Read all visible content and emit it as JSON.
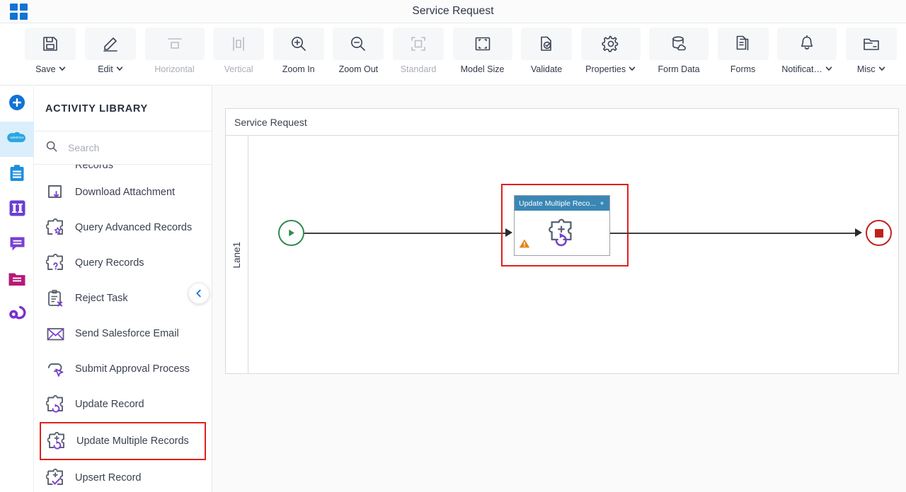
{
  "titlebar": {
    "title": "Service Request",
    "app_grid_icon": "apps-grid-icon"
  },
  "toolbar": {
    "buttons": [
      {
        "label": "Save",
        "icon": "save-disk-icon",
        "caret": true,
        "disabled": false
      },
      {
        "label": "Edit",
        "icon": "pencil-edit-icon",
        "caret": true,
        "disabled": false
      },
      {
        "label": "Horizontal",
        "icon": "horizontal-align-icon",
        "caret": false,
        "disabled": true
      },
      {
        "label": "Vertical",
        "icon": "vertical-align-icon",
        "caret": false,
        "disabled": true
      },
      {
        "label": "Zoom In",
        "icon": "zoom-in-icon",
        "caret": false,
        "disabled": false
      },
      {
        "label": "Zoom Out",
        "icon": "zoom-out-icon",
        "caret": false,
        "disabled": false
      },
      {
        "label": "Standard",
        "icon": "standard-frame-icon",
        "caret": false,
        "disabled": true
      },
      {
        "label": "Model Size",
        "icon": "model-size-icon",
        "caret": false,
        "disabled": false
      },
      {
        "label": "Validate",
        "icon": "validate-doc-icon",
        "caret": false,
        "disabled": false
      },
      {
        "label": "Properties",
        "icon": "gear-icon",
        "caret": true,
        "disabled": false
      },
      {
        "label": "Form Data",
        "icon": "database-cloud-icon",
        "caret": false,
        "disabled": false
      },
      {
        "label": "Forms",
        "icon": "documents-icon",
        "caret": false,
        "disabled": false
      },
      {
        "label": "Notificat…",
        "icon": "bell-icon",
        "caret": true,
        "disabled": false
      },
      {
        "label": "Misc",
        "icon": "folder-icon",
        "caret": true,
        "disabled": false
      }
    ]
  },
  "rail": {
    "items": [
      {
        "name": "add-new",
        "icon": "plus-circle-icon",
        "color": "#1273d4",
        "active": false
      },
      {
        "name": "salesforce",
        "icon": "salesforce-cloud-icon",
        "color": "#29a8e0",
        "active": true
      },
      {
        "name": "tasks",
        "icon": "clipboard-icon",
        "color": "#1d8fe0",
        "active": false
      },
      {
        "name": "swimlanes",
        "icon": "swimlane-icon",
        "color": "#6b3fd4",
        "active": false
      },
      {
        "name": "annotations",
        "icon": "comment-icon",
        "color": "#7a3fd4",
        "active": false
      },
      {
        "name": "folders",
        "icon": "folder-filled-icon",
        "color": "#b51a77",
        "active": false
      },
      {
        "name": "integrations",
        "icon": "spiral-icon",
        "color": "#7a30cf",
        "active": false
      }
    ]
  },
  "panel": {
    "title": "ACTIVITY LIBRARY",
    "search": {
      "value": "",
      "placeholder": "Search",
      "icon": "search-icon"
    },
    "collapse_icon": "chevron-left-icon",
    "clipped_top_item": "Records",
    "items": [
      {
        "label": "Download Attachment",
        "icon": "download-attachment-icon",
        "highlight": false
      },
      {
        "label": "Query Advanced Records",
        "icon": "puzzle-star-icon",
        "highlight": false
      },
      {
        "label": "Query Records",
        "icon": "puzzle-question-icon",
        "highlight": false
      },
      {
        "label": "Reject Task",
        "icon": "reject-task-icon",
        "highlight": false
      },
      {
        "label": "Send Salesforce Email",
        "icon": "envelope-icon",
        "highlight": false
      },
      {
        "label": "Submit Approval Process",
        "icon": "cursor-approval-icon",
        "highlight": false
      },
      {
        "label": "Update Record",
        "icon": "puzzle-refresh-icon",
        "highlight": false
      },
      {
        "label": "Update Multiple Records",
        "icon": "puzzle-plus-refresh-icon",
        "highlight": true
      },
      {
        "label": "Upsert Record",
        "icon": "puzzle-plus-check-icon",
        "highlight": false
      }
    ]
  },
  "canvas": {
    "pool_title": "Service Request",
    "lane_label": "Lane1",
    "start_event": {
      "name": "start-event",
      "icon": "play-triangle-icon",
      "color": "#2e8b4f"
    },
    "end_event": {
      "name": "end-event",
      "icon": "stop-square-icon",
      "color": "#c0201d"
    },
    "task": {
      "title": "Update Multiple Reco...",
      "header_color": "#3a87b5",
      "gear_icon": "gear-icon",
      "body_icon": "puzzle-plus-refresh-icon",
      "warning_icon": "warning-triangle-icon",
      "warning_color": "#e8821a",
      "selected": true,
      "selection_color": "#e0201b"
    }
  },
  "colors": {
    "accent_blue": "#1273d4",
    "selection_red": "#e0201b",
    "purple": "#7a3fd4",
    "node_header": "#3a87b5"
  }
}
